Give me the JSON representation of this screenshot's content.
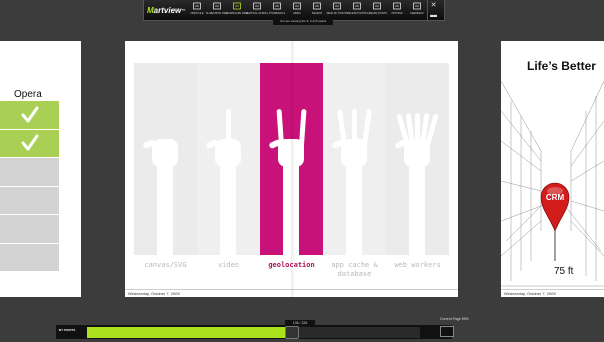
{
  "toolbar": {
    "logo_prefix": "M",
    "logo_rest": "artview",
    "logo_tm": "™",
    "buttons": [
      {
        "icon": "open-file-icon",
        "label": "OPEN FILE"
      },
      {
        "icon": "slideshow-icon",
        "label": "SLIDESHOW VIEW"
      },
      {
        "icon": "landscape-view-icon",
        "label": "LANDSCAPE VIEW"
      },
      {
        "icon": "vertical-scroll-icon",
        "label": "VERTICAL SCROLL"
      },
      {
        "icon": "thumbnails-icon",
        "label": "THUMBNAILS"
      },
      {
        "icon": "index-icon",
        "label": "INDEX"
      },
      {
        "icon": "search-icon",
        "label": "SEARCH"
      },
      {
        "icon": "send-my-points-icon",
        "label": "SEND MY POINTS"
      },
      {
        "icon": "delete-points-icon",
        "label": "DELETE POINTS"
      },
      {
        "icon": "create-points-icon",
        "label": "CREATE POINTS"
      },
      {
        "icon": "options-icon",
        "label": "OPTIONS"
      },
      {
        "icon": "feedback-icon",
        "label": "FEEDBACK"
      }
    ],
    "pages_badge": "You are viewing the 9, 2,473 spans"
  },
  "left_page": {
    "heading": "Opera",
    "cells": [
      true,
      true,
      false,
      false,
      false,
      false
    ]
  },
  "main_page": {
    "columns": [
      {
        "label": "canvas/SVG",
        "active": false
      },
      {
        "label": "video",
        "active": false
      },
      {
        "label": "geolocation",
        "active": true
      },
      {
        "label": "app cache & database",
        "active": false
      },
      {
        "label": "web workers",
        "active": false
      }
    ],
    "date": "Wednesday, October 7, 2009"
  },
  "right_page": {
    "title": "Life’s Better",
    "pin_label": "CRM",
    "pin_value": "75 ft",
    "date": "Wednesday, October 7, 2009"
  },
  "bottom": {
    "my_points": "MY POINTS",
    "page_count": "136 / 226",
    "progress": 0.6,
    "zoom_label": "Current Page 89%"
  },
  "colors": {
    "accent_green": "#a9e21c",
    "geolocation_magenta": "#c8127a",
    "check_green": "#a9cf55",
    "pin_red": "#d21c1c"
  }
}
